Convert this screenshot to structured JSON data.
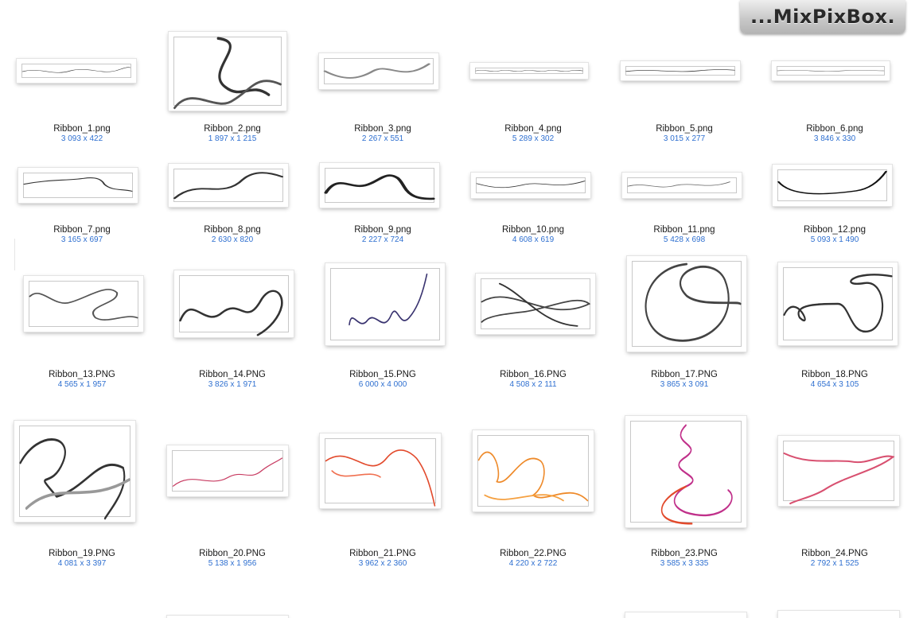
{
  "brand": {
    "logo_text": "...MixPixBox."
  },
  "files": [
    {
      "name": "Ribbon_1.png",
      "dims": "3 093 x 422"
    },
    {
      "name": "Ribbon_2.png",
      "dims": "1 897 x 1 215"
    },
    {
      "name": "Ribbon_3.png",
      "dims": "2 267 x 551"
    },
    {
      "name": "Ribbon_4.png",
      "dims": "5 289 x 302"
    },
    {
      "name": "Ribbon_5.png",
      "dims": "3 015 x 277"
    },
    {
      "name": "Ribbon_6.png",
      "dims": "3 846 x 330"
    },
    {
      "name": "Ribbon_7.png",
      "dims": "3 165 x 697"
    },
    {
      "name": "Ribbon_8.png",
      "dims": "2 630 x 820"
    },
    {
      "name": "Ribbon_9.png",
      "dims": "2 227 x 724"
    },
    {
      "name": "Ribbon_10.png",
      "dims": "4 608 x 619"
    },
    {
      "name": "Ribbon_11.png",
      "dims": "5 428 x 698"
    },
    {
      "name": "Ribbon_12.png",
      "dims": "5 093 x 1 490"
    },
    {
      "name": "Ribbon_13.PNG",
      "dims": "4 565 x 1 957"
    },
    {
      "name": "Ribbon_14.PNG",
      "dims": "3 826 x 1 971"
    },
    {
      "name": "Ribbon_15.PNG",
      "dims": "6 000 x 4 000"
    },
    {
      "name": "Ribbon_16.PNG",
      "dims": "4 508 x 2 111"
    },
    {
      "name": "Ribbon_17.PNG",
      "dims": "3 865 x 3 091"
    },
    {
      "name": "Ribbon_18.PNG",
      "dims": "4 654 x 3 105"
    },
    {
      "name": "Ribbon_19.PNG",
      "dims": "4 081 x 3 397"
    },
    {
      "name": "Ribbon_20.PNG",
      "dims": "5 138 x 1 956"
    },
    {
      "name": "Ribbon_21.PNG",
      "dims": "3 962 x 2 360"
    },
    {
      "name": "Ribbon_22.PNG",
      "dims": "4 220 x 2 722"
    },
    {
      "name": "Ribbon_23.PNG",
      "dims": "3 585 x 3 335"
    },
    {
      "name": "Ribbon_24.PNG",
      "dims": "2 792 x 1 525"
    }
  ],
  "colors": {
    "filename_text": "#1a1a1a",
    "dimension_text": "#2e6fd0",
    "ribbon_gray": "#444444",
    "ribbon_navy": "#3a3470",
    "ribbon_pink": "#c83c62",
    "ribbon_red": "#e24a2c",
    "ribbon_orange": "#ee8a2a",
    "ribbon_magenta": "#c0308a"
  }
}
